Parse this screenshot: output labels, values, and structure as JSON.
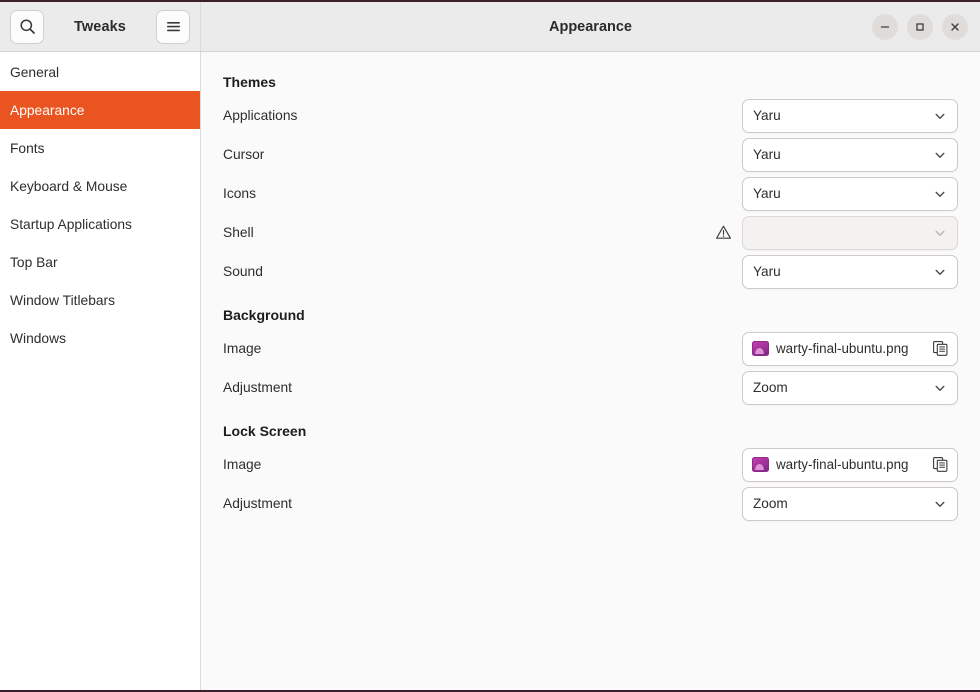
{
  "window": {
    "app_name": "Tweaks",
    "title": "Appearance",
    "search_icon": "search-icon",
    "menu_icon": "hamburger-menu-icon",
    "controls": {
      "minimize_label": "–",
      "maximize_label": "□",
      "close_label": "✕"
    },
    "desktop_bg": "#3b1f2b",
    "accent_color": "#e95420"
  },
  "sidebar": {
    "items": [
      {
        "label": "General",
        "active": false
      },
      {
        "label": "Appearance",
        "active": true
      },
      {
        "label": "Fonts",
        "active": false
      },
      {
        "label": "Keyboard & Mouse",
        "active": false
      },
      {
        "label": "Startup Applications",
        "active": false
      },
      {
        "label": "Top Bar",
        "active": false
      },
      {
        "label": "Window Titlebars",
        "active": false
      },
      {
        "label": "Windows",
        "active": false
      }
    ]
  },
  "content": {
    "groups": [
      {
        "title": "Themes",
        "rows": [
          {
            "label": "Applications",
            "control": "combo",
            "value": "Yaru",
            "disabled": false,
            "warning": false
          },
          {
            "label": "Cursor",
            "control": "combo",
            "value": "Yaru",
            "disabled": false,
            "warning": false
          },
          {
            "label": "Icons",
            "control": "combo",
            "value": "Yaru",
            "disabled": false,
            "warning": false
          },
          {
            "label": "Shell",
            "control": "combo",
            "value": "",
            "disabled": true,
            "warning": true
          },
          {
            "label": "Sound",
            "control": "combo",
            "value": "Yaru",
            "disabled": false,
            "warning": false
          }
        ]
      },
      {
        "title": "Background",
        "rows": [
          {
            "label": "Image",
            "control": "file",
            "value": "warty-final-ubuntu.png",
            "disabled": false,
            "warning": false
          },
          {
            "label": "Adjustment",
            "control": "combo",
            "value": "Zoom",
            "disabled": false,
            "warning": false
          }
        ]
      },
      {
        "title": "Lock Screen",
        "rows": [
          {
            "label": "Image",
            "control": "file",
            "value": "warty-final-ubuntu.png",
            "disabled": false,
            "warning": false
          },
          {
            "label": "Adjustment",
            "control": "combo",
            "value": "Zoom",
            "disabled": false,
            "warning": false
          }
        ]
      }
    ]
  }
}
